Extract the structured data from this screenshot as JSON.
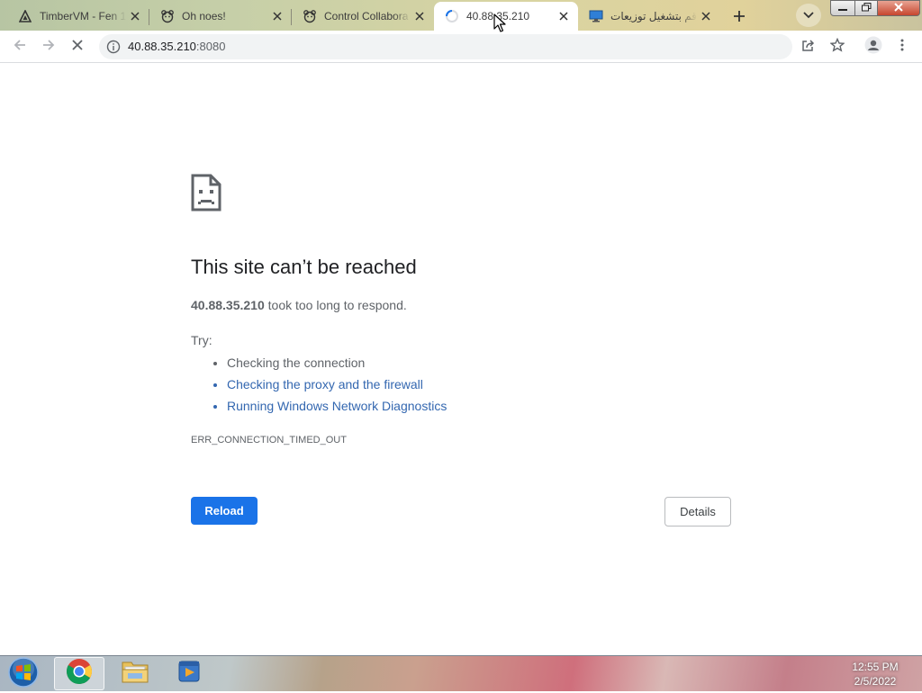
{
  "browser": {
    "tabs": [
      {
        "title": "TimberVM - Fen 1",
        "icon": "triangle-logo-icon",
        "active": false
      },
      {
        "title": "Oh noes!",
        "icon": "bear-face-icon",
        "active": false
      },
      {
        "title": "Control Collabora",
        "icon": "bear-face-icon",
        "active": false
      },
      {
        "title": "40.88.35.210",
        "icon": "loading-spinner-icon",
        "active": true
      },
      {
        "title": "قم بتشغيل توزيعات",
        "icon": "monitor-icon",
        "active": false
      }
    ],
    "address_bar": {
      "host": "40.88.35.210",
      "port": ":8080"
    }
  },
  "error_page": {
    "title": "This site can’t be reached",
    "host": "40.88.35.210",
    "description_suffix": " took too long to respond.",
    "try_label": "Try:",
    "suggestions": [
      "Checking the connection",
      "Checking the proxy and the firewall",
      "Running Windows Network Diagnostics"
    ],
    "error_code": "ERR_CONNECTION_TIMED_OUT",
    "reload_label": "Reload",
    "details_label": "Details"
  },
  "taskbar": {
    "time": "12:55 PM",
    "date": "2/5/2022"
  },
  "colors": {
    "accent": "#1a73e8",
    "link": "#3367b0"
  }
}
